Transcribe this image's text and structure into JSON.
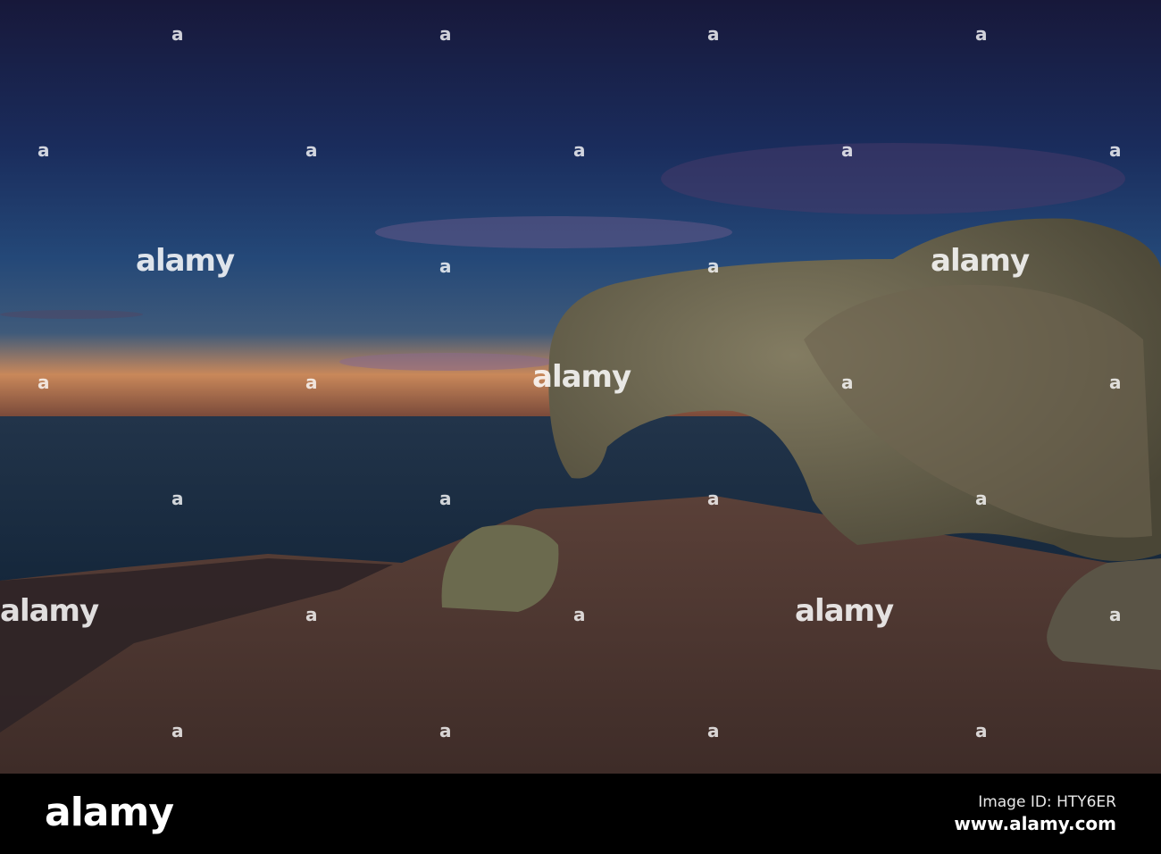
{
  "watermark": {
    "text": "alamy",
    "small_mark": "a"
  },
  "footer": {
    "logo": "alamy",
    "image_id": "Image ID: HTY6ER",
    "url": "www.alamy.com"
  }
}
